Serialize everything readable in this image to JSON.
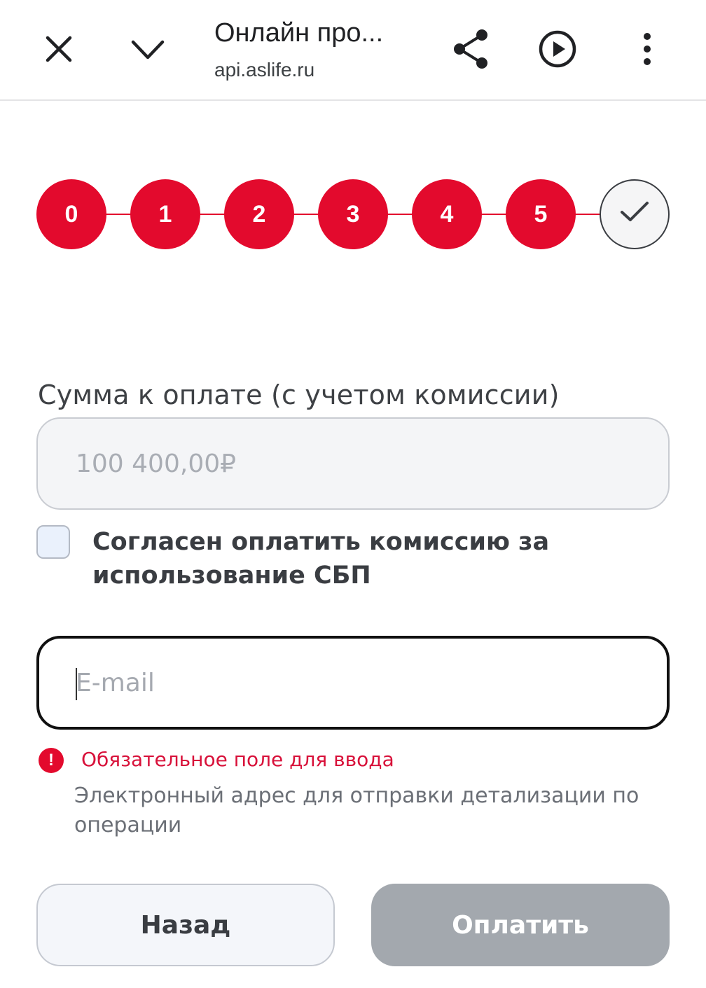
{
  "topbar": {
    "title": "Онлайн про...",
    "url": "api.aslife.ru",
    "icons": [
      "close-icon",
      "chevron-down-icon",
      "share-icon",
      "play-icon",
      "more-vertical-icon"
    ]
  },
  "stepper": {
    "steps": [
      "0",
      "1",
      "2",
      "3",
      "4",
      "5"
    ],
    "final_icon": "check-icon",
    "accent_color": "#e30a2d"
  },
  "amount": {
    "label": "Сумма к оплате (с учетом комиссии)",
    "value": "100 400,00₽"
  },
  "consent": {
    "checked": false,
    "label": "Согласен оплатить комиссию за использование СБП"
  },
  "email": {
    "value": "",
    "placeholder": "E-mail",
    "error": "Обязательное поле для ввода",
    "hint": "Электронный адрес для отправки детализации по операции"
  },
  "buttons": {
    "back": "Назад",
    "pay": "Оплатить"
  }
}
